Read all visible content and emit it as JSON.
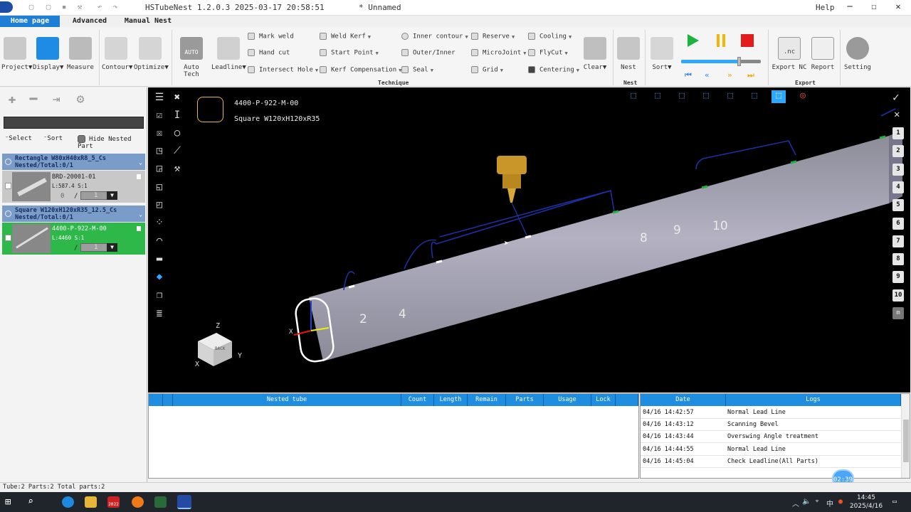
{
  "app": {
    "title": "HSTubeNest 1.2.0.3 2025-03-17 20:58:51",
    "document": "* Unnamed",
    "help": "Help"
  },
  "tabs": [
    {
      "label": "Home page",
      "active": true
    },
    {
      "label": "Advanced",
      "active": false
    },
    {
      "label": "Manual Nest",
      "active": false
    }
  ],
  "ribbon": {
    "project": "Project",
    "display": "Display",
    "measure": "Measure",
    "contour": "Contour",
    "optimize": "Optimize",
    "auto_tech": "Auto Tech",
    "auto_tech_icon": "AUTO",
    "leadline": "Leadline",
    "mark_weld": "Mark weld",
    "hand_cut": "Hand cut",
    "intersect_hole": "Intersect Hole",
    "weld_kerf": "Weld Kerf",
    "start_point": "Start Point",
    "kerf_compensation": "Kerf Compensation",
    "inner_contour": "Inner contour",
    "outer_inner": "Outer/Inner",
    "seal": "Seal",
    "reserve": "Reserve",
    "microjoint": "MicroJoint",
    "grid": "Grid",
    "cooling": "Cooling",
    "flycut": "FlyCut",
    "centering": "Centering",
    "clear": "Clear",
    "technique_group": "Technique",
    "nest": "Nest",
    "nest_group": "Nest",
    "sort": "Sort",
    "export_nc": "Export NC",
    "export_nc_icon": ".nc",
    "report": "Report",
    "export_group": "Export",
    "setting": "Setting"
  },
  "left": {
    "filter_select": "Select",
    "filter_sort": "Sort",
    "hide_nested": "Hide Nested Part",
    "groups": [
      {
        "title1": "Rectangle W80xH40xR8_5_Cs",
        "title2": "Nested/Total:0/1",
        "item_name": "BRD-20001-01",
        "item_len": "L:587.4 S:1",
        "qty": "0",
        "qty_input": "1"
      },
      {
        "title1": "Square W120xH120xR35_12.5_Cs",
        "title2": "Nested/Total:0/1",
        "item_name": "4400-P-922-M-00",
        "item_len": "L:4460 S:1",
        "qty": "",
        "qty_input": "1"
      }
    ]
  },
  "view": {
    "part_name": "4400-P-922-M-00",
    "part_spec": "Square W120xH120xR35",
    "sequence_labels": [
      "2",
      "4",
      "8",
      "9",
      "10"
    ],
    "side_numbers": [
      "1",
      "2",
      "3",
      "4",
      "5",
      "6",
      "7",
      "8",
      "9",
      "10",
      "m"
    ],
    "cube_face": "BACK",
    "axis_x": "X",
    "axis_y": "Y",
    "axis_z": "Z"
  },
  "nest_table": {
    "columns": [
      "",
      "",
      "Nested tube",
      "Count",
      "Length",
      "Remain",
      "Parts",
      "Usage",
      "Lock"
    ]
  },
  "log_table": {
    "columns": [
      "Date",
      "Logs"
    ],
    "rows": [
      {
        "date": "04/16 14:42:57",
        "log": "Normal Lead Line"
      },
      {
        "date": "04/16 14:43:12",
        "log": "Scanning Bevel"
      },
      {
        "date": "04/16 14:43:44",
        "log": "Overswing Angle treatment"
      },
      {
        "date": "04/16 14:44:55",
        "log": "Normal Lead Line"
      },
      {
        "date": "04/16 14:45:04",
        "log": "Check Leadline(All Parts)"
      }
    ]
  },
  "timer": "02:39",
  "status": "Tube:2 Parts:2 Total parts:2",
  "taskbar": {
    "time": "14:45",
    "date": "2025/4/16",
    "lang": "中",
    "badge": "2022"
  }
}
